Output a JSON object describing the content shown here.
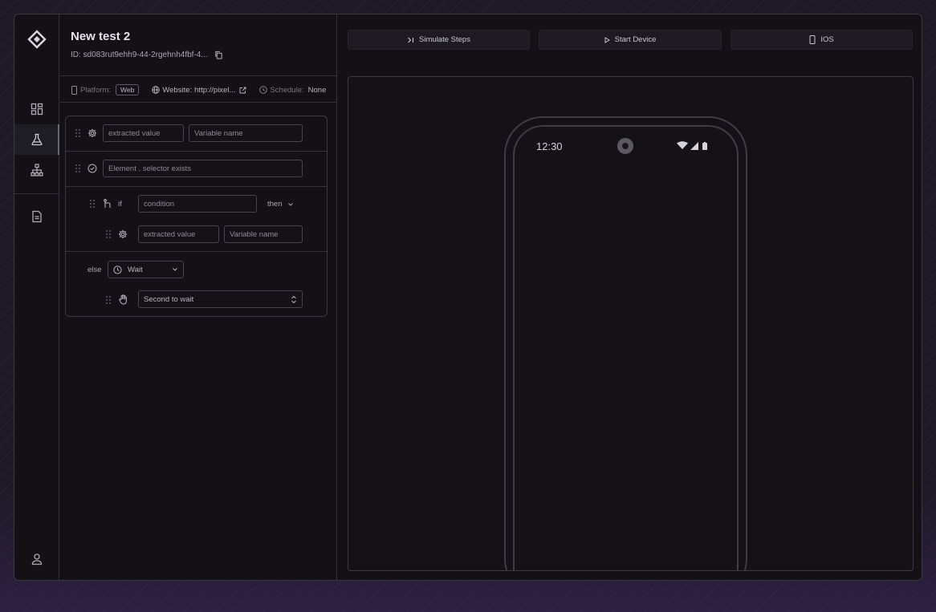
{
  "test": {
    "title": "New test 2",
    "id_text": "ID: sd083rut9ehh9-44-2rgehnh4fbf-4..."
  },
  "meta": {
    "platform_label": "Platform:",
    "platform_value": "Web",
    "website_label": "Website:",
    "website_value": "http://pixel...",
    "schedule_label": "Schedule:",
    "schedule_value": "None"
  },
  "steps": {
    "step1": {
      "value_placeholder": "extracted value",
      "name_placeholder": "Variable name"
    },
    "step2": {
      "text": "Element . selector exists"
    },
    "conditional": {
      "if_label": "if",
      "condition_placeholder": "condition",
      "then_label": "then",
      "inner": {
        "value_placeholder": "extracted value",
        "name_placeholder": "Variable name"
      },
      "else_label": "else",
      "else_select": "Wait",
      "wait_field": "Second to wait"
    }
  },
  "toolbar": {
    "simulate_label": "Simulate Steps",
    "start_label": "Start Device",
    "device_label": "IOS"
  },
  "device_screen": {
    "clock": "12:30"
  },
  "icons": {
    "logo": "logo-icon",
    "dashboard": "dashboard-icon",
    "tests": "flask-icon",
    "flows": "hierarchy-icon",
    "docs": "document-icon",
    "profile": "user-icon"
  }
}
